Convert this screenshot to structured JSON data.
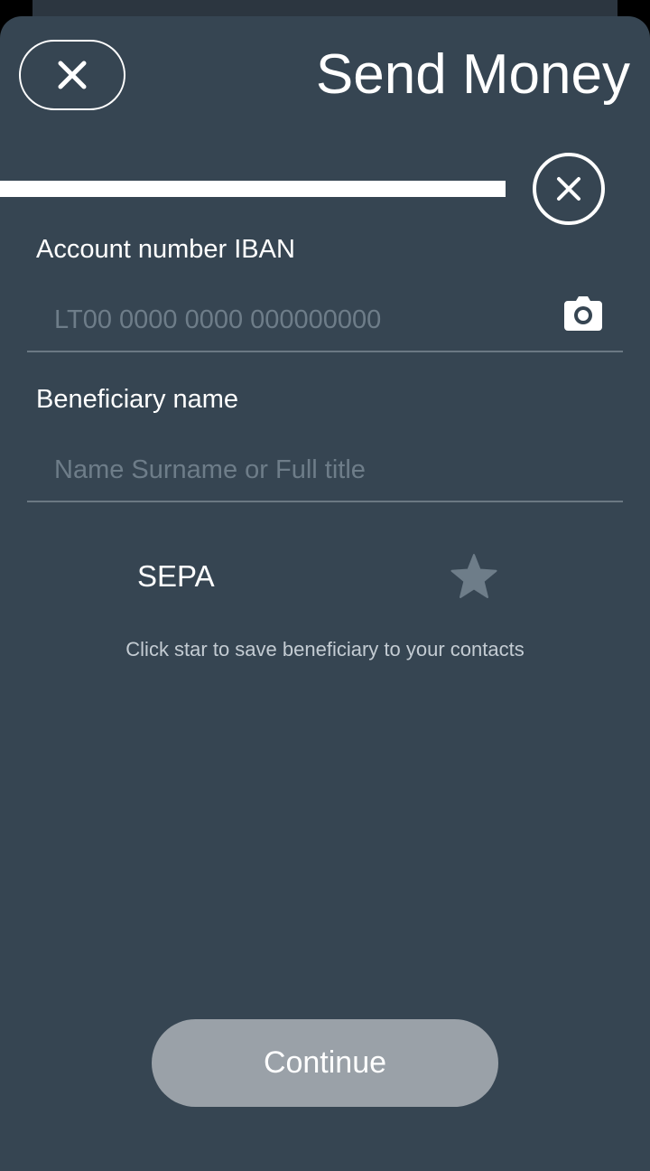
{
  "header": {
    "title": "Send Money",
    "close_icon": "close-icon"
  },
  "progress": {
    "filled_fraction": 0.78,
    "clear_icon": "close-circle-icon"
  },
  "form": {
    "iban": {
      "label": "Account number IBAN",
      "placeholder": "LT00 0000 0000 000000000",
      "value": "",
      "action_icon": "camera-icon"
    },
    "beneficiary": {
      "label": "Beneficiary name",
      "placeholder": "Name Surname or Full title",
      "value": ""
    }
  },
  "payment_type": {
    "label": "SEPA",
    "favorite_icon": "star-icon",
    "hint": "Click star to save beneficiary to your contacts"
  },
  "actions": {
    "continue_label": "Continue"
  },
  "colors": {
    "background": "#364552",
    "text": "#ffffff",
    "placeholder": "#6e7d89",
    "divider": "#6b7883",
    "star": "#6e7d89",
    "button_disabled": "#9aa1a8"
  }
}
